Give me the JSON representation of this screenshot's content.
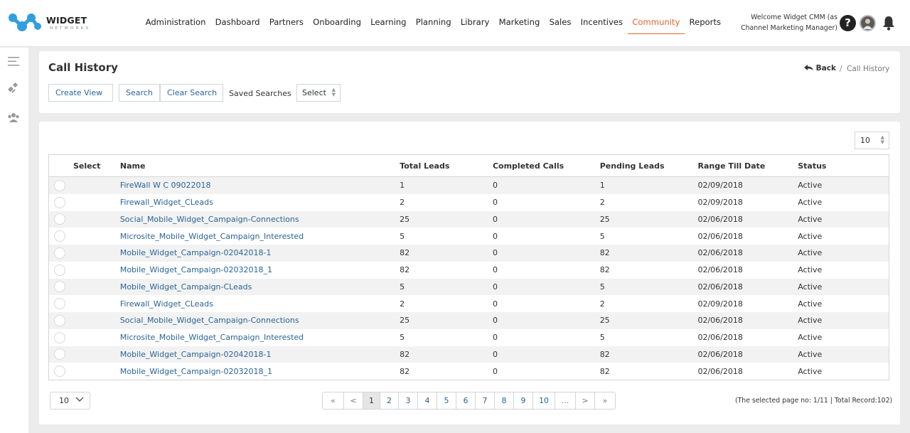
{
  "header": {
    "brand": "WIDGET",
    "brand_sub": "NETWORKS",
    "nav": [
      "Administration",
      "Dashboard",
      "Partners",
      "Onboarding",
      "Learning",
      "Planning",
      "Library",
      "Marketing",
      "Sales",
      "Incentives",
      "Community",
      "Reports"
    ],
    "active_nav": "Community",
    "welcome_line1": "Welcome Widget CMM (as",
    "welcome_line2": "Channel Marketing Manager)",
    "help_icon": "?"
  },
  "page": {
    "title": "Call History",
    "back_label": "Back",
    "breadcrumb_sep": "/",
    "breadcrumb_current": "Call History",
    "create_view_label": "Create View",
    "search_label": "Search",
    "clear_search_label": "Clear Search",
    "saved_searches_label": "Saved Searches",
    "saved_searches_value": "Select",
    "page_size_top": "10"
  },
  "table": {
    "columns": [
      "Select",
      "Name",
      "Total Leads",
      "Completed Calls",
      "Pending Leads",
      "Range Till Date",
      "Status"
    ],
    "rows": [
      [
        "FireWall W C 09022018",
        "1",
        "0",
        "1",
        "02/09/2018",
        "Active"
      ],
      [
        "Firewall_Widget_CLeads",
        "2",
        "0",
        "2",
        "02/09/2018",
        "Active"
      ],
      [
        "Social_Mobile_Widget_Campaign-Connections",
        "25",
        "0",
        "25",
        "02/06/2018",
        "Active"
      ],
      [
        "Microsite_Mobile_Widget_Campaign_Interested",
        "5",
        "0",
        "5",
        "02/06/2018",
        "Active"
      ],
      [
        "Mobile_Widget_Campaign-02042018-1",
        "82",
        "0",
        "82",
        "02/06/2018",
        "Active"
      ],
      [
        "Mobile_Widget_Campaign-02032018_1",
        "82",
        "0",
        "82",
        "02/06/2018",
        "Active"
      ],
      [
        "Mobile_Widget_Campaign-CLeads",
        "5",
        "0",
        "5",
        "02/06/2018",
        "Active"
      ],
      [
        "Firewall_Widget_CLeads",
        "2",
        "0",
        "2",
        "02/09/2018",
        "Active"
      ],
      [
        "Social_Mobile_Widget_Campaign-Connections",
        "25",
        "0",
        "25",
        "02/06/2018",
        "Active"
      ],
      [
        "Microsite_Mobile_Widget_Campaign_Interested",
        "5",
        "0",
        "5",
        "02/06/2018",
        "Active"
      ],
      [
        "Mobile_Widget_Campaign-02042018-1",
        "82",
        "0",
        "82",
        "02/06/2018",
        "Active"
      ],
      [
        "Mobile_Widget_Campaign-02032018_1",
        "82",
        "0",
        "82",
        "02/06/2018",
        "Active"
      ]
    ]
  },
  "footer": {
    "page_size": "10",
    "pages": [
      "«",
      "<",
      "1",
      "2",
      "3",
      "4",
      "5",
      "6",
      "7",
      "8",
      "9",
      "10",
      "...",
      ">",
      "»"
    ],
    "current_page": "1",
    "record_info": "(The selected page no: 1/11 | Total Record:102)"
  },
  "colors": {
    "accent": "#e8632b",
    "link": "#2a6496",
    "logo_blue": "#2f9fe0"
  },
  "icons": [
    "menu-icon",
    "satellite-icon",
    "group-icon",
    "help-icon",
    "avatar",
    "bell-icon",
    "chevron-down-icon"
  ]
}
